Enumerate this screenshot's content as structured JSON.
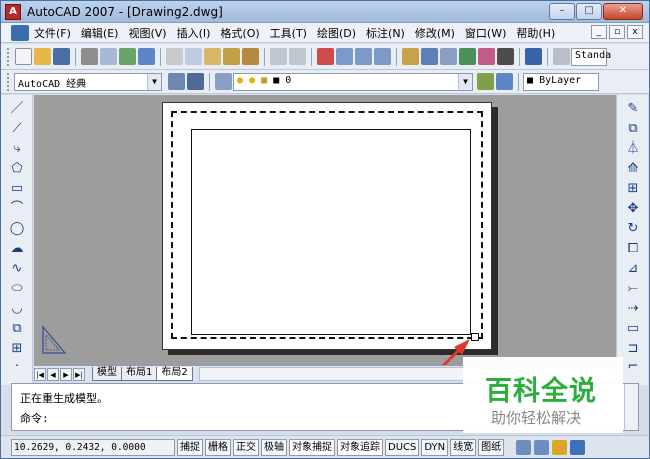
{
  "window": {
    "title": "AutoCAD 2007 - [Drawing2.dwg]",
    "controls": [
      "–",
      "□",
      "✕"
    ],
    "mdi_controls": [
      "_",
      "▫",
      "x"
    ]
  },
  "menu": {
    "items": [
      "文件(F)",
      "编辑(E)",
      "视图(V)",
      "插入(I)",
      "格式(O)",
      "工具(T)",
      "绘图(D)",
      "标注(N)",
      "修改(M)",
      "窗口(W)",
      "帮助(H)"
    ]
  },
  "toolbar": {
    "text_style": "Standa",
    "workspace": "AutoCAD 经典",
    "layer": "0",
    "color": "ByLayer"
  },
  "tabs": {
    "nav": [
      "|◀",
      "◀",
      "▶",
      "▶|"
    ],
    "items": [
      "模型",
      "布局1",
      "布局2"
    ],
    "active": "布局2"
  },
  "command": {
    "history": "正在重生成模型。",
    "prompt": "命令:"
  },
  "status": {
    "coords": "10.2629, 0.2432, 0.0000",
    "buttons": [
      "捕捉",
      "栅格",
      "正交",
      "极轴",
      "对象捕捉",
      "对象追踪",
      "DUCS",
      "DYN",
      "线宽",
      "图纸"
    ]
  },
  "watermark": {
    "title": "百科全说",
    "subtitle": "助你轻松解决"
  },
  "colors": {
    "accent": "#2cae3c",
    "arrow": "#e0382c",
    "canvas": "#9d9d9d"
  }
}
